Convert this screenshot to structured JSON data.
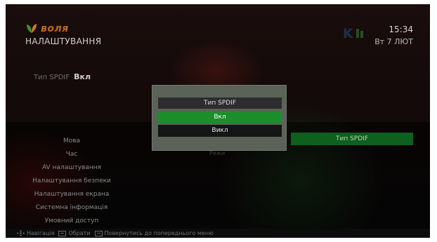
{
  "header": {
    "brand": "воля",
    "title": "НАЛАШТУВАННЯ",
    "time": "15:34",
    "date": "Вт 7 ЛЮТ"
  },
  "current_setting": {
    "label": "Тип SPDIF",
    "value": "Вкл"
  },
  "menu": {
    "items": [
      "Мова",
      "Час",
      "AV налаштування",
      "Налаштування безпеки",
      "Налаштування екрана",
      "Системна інформація",
      "Умовний доступ"
    ]
  },
  "submenu": {
    "selected_item": "Тип SPDIF",
    "dim_item": "Режи"
  },
  "dialog": {
    "title": "Тип SPDIF",
    "options": [
      "Вкл",
      "Викл"
    ],
    "selected_index": 0
  },
  "footer": {
    "navigate": "Навігація",
    "select": "Обрати",
    "back": "Повернутись до попереднього меню"
  },
  "colors": {
    "accent_green": "#1b8d2b",
    "brand_orange": "#c06a1a"
  },
  "icons": {
    "brand": "leaf-logo-icon",
    "navigate": "arrows-icon",
    "select": "ok-button-icon",
    "back": "back-button-icon"
  }
}
